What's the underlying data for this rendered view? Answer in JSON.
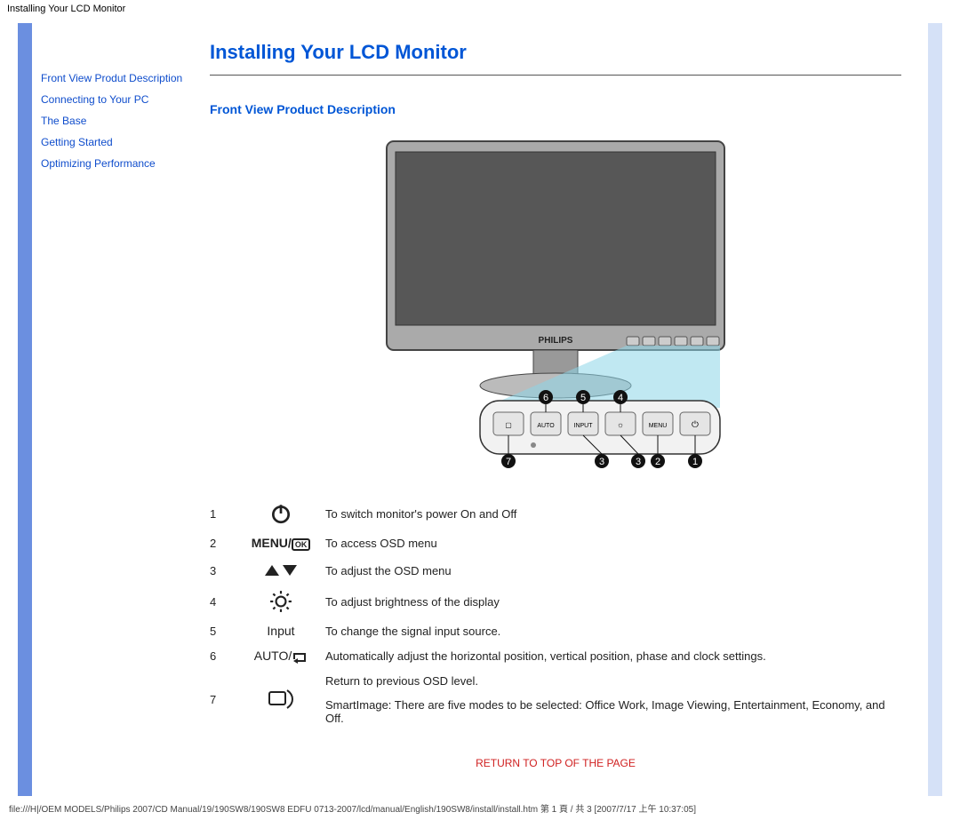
{
  "window_title": "Installing Your LCD Monitor",
  "sidebar": {
    "items": [
      {
        "label": "Front View Produt Description"
      },
      {
        "label": "Connecting to Your PC"
      },
      {
        "label": "The Base"
      },
      {
        "label": "Getting Started"
      },
      {
        "label": "Optimizing Performance"
      }
    ]
  },
  "page": {
    "title": "Installing Your LCD Monitor",
    "section_heading": "Front View Product Description",
    "return_link": "RETURN TO TOP OF THE PAGE"
  },
  "legend": [
    {
      "num": "1",
      "icon": "power-icon",
      "desc": "To switch monitor's power On and Off"
    },
    {
      "num": "2",
      "icon": "menu-ok-icon",
      "icon_text": "MENU / OK",
      "desc": "To access OSD menu"
    },
    {
      "num": "3",
      "icon": "up-down-icon",
      "desc": "To adjust the OSD menu"
    },
    {
      "num": "4",
      "icon": "brightness-icon",
      "desc": "To adjust brightness of the display"
    },
    {
      "num": "5",
      "icon": "input-icon",
      "icon_text": "Input",
      "desc": "To change the signal input source."
    },
    {
      "num": "6",
      "icon": "auto-return-icon",
      "icon_text": "AUTO/↩",
      "desc": "Automatically adjust the horizontal position, vertical position, phase and clock settings."
    },
    {
      "num": "7",
      "icon": "smartimage-icon",
      "desc_a": "Return to previous OSD level.",
      "desc_b": "SmartImage: There are five modes to be selected: Office Work, Image Viewing, Entertainment, Economy, and Off."
    }
  ],
  "footer_path": "file:///H|/OEM MODELS/Philips 2007/CD Manual/19/190SW8/190SW8 EDFU 0713-2007/lcd/manual/English/190SW8/install/install.htm 第 1 頁 / 共 3  [2007/7/17 上午 10:37:05]"
}
